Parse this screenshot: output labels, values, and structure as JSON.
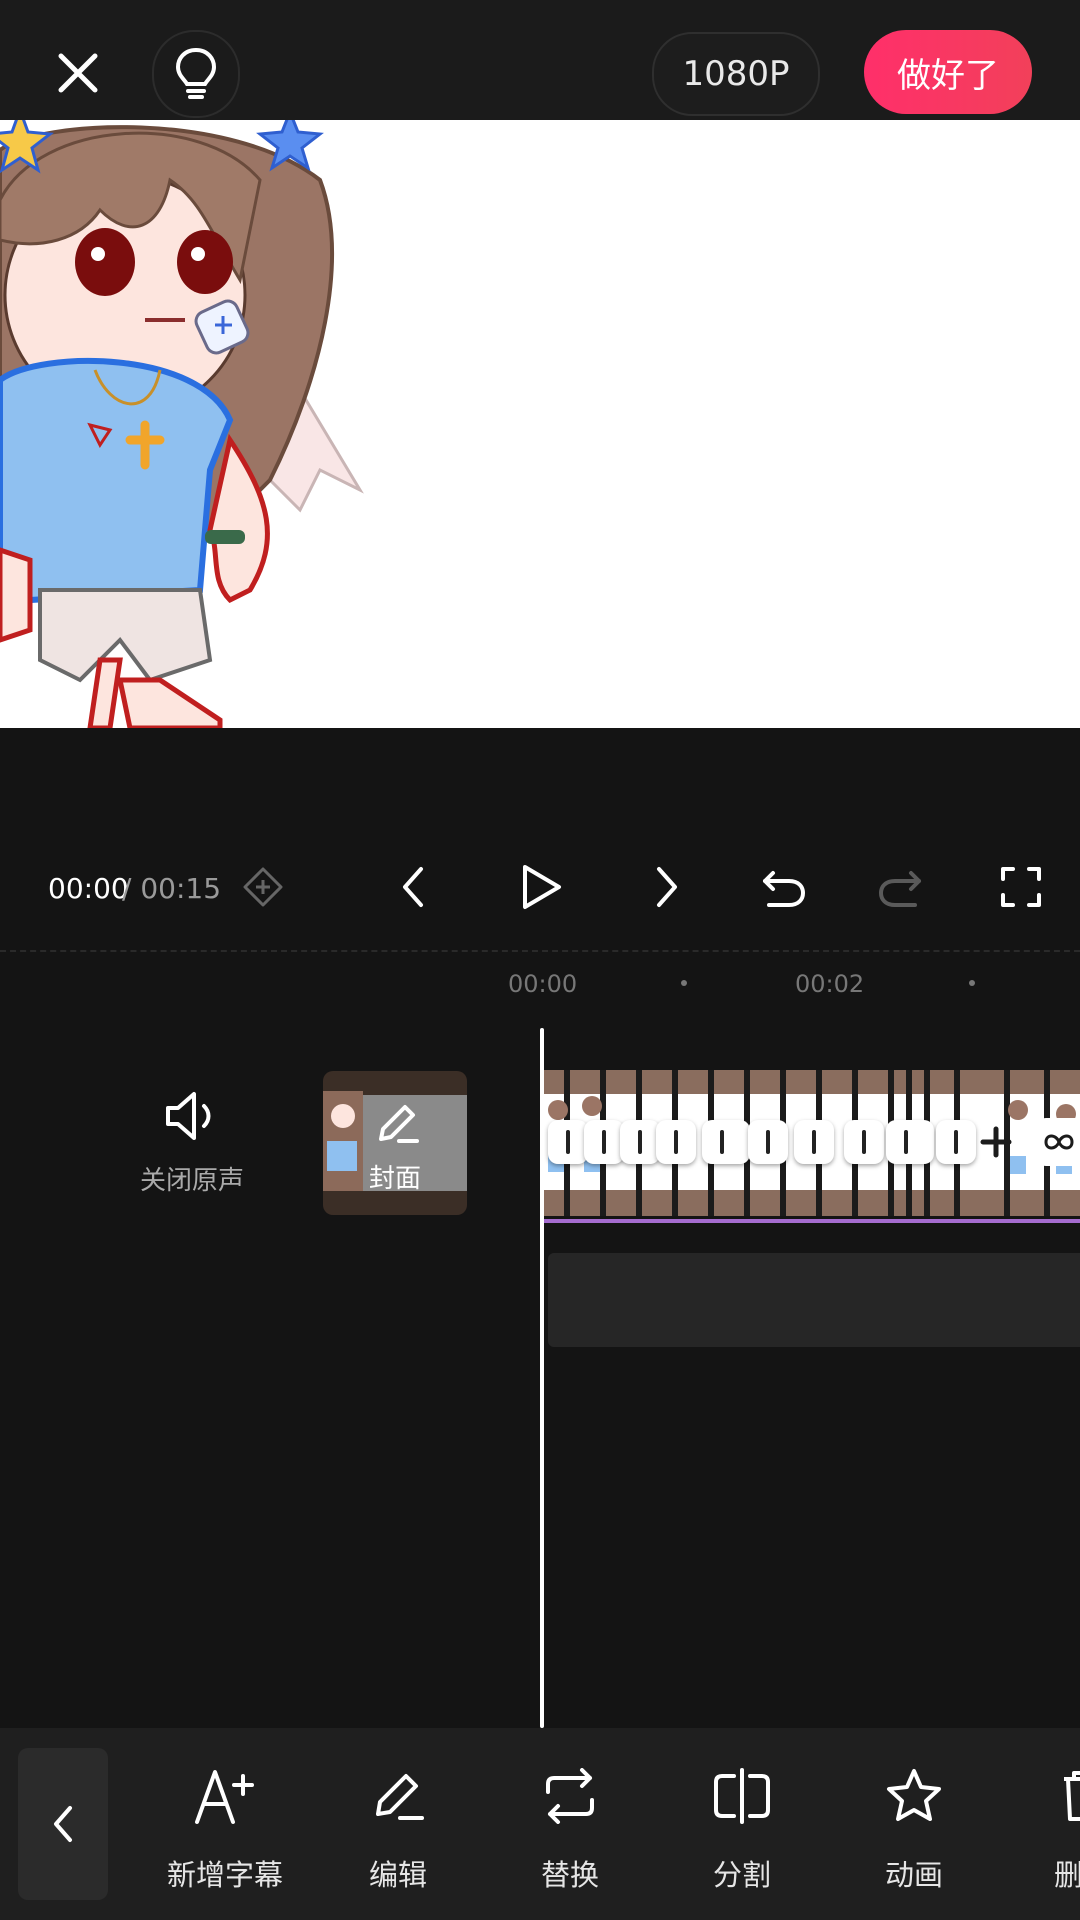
{
  "topbar": {
    "resolution_label": "1080P",
    "done_label": "做好了"
  },
  "player": {
    "time_current": "00:00",
    "time_total": " / 00:15"
  },
  "timeline": {
    "ruler": [
      "00:00",
      "00:02"
    ],
    "mute_label": "关闭原声",
    "cover_label": "封面"
  },
  "toolbar": {
    "items": [
      {
        "label": "新增字幕",
        "icon": "add-text-icon"
      },
      {
        "label": "编辑",
        "icon": "edit-icon"
      },
      {
        "label": "替换",
        "icon": "replace-icon"
      },
      {
        "label": "分割",
        "icon": "split-icon"
      },
      {
        "label": "动画",
        "icon": "star-icon"
      },
      {
        "label": "删",
        "icon": "trash-icon"
      }
    ]
  },
  "colors": {
    "accent": "#ff2f6a",
    "background": "#141414",
    "track_underline": "#a56ccf"
  }
}
